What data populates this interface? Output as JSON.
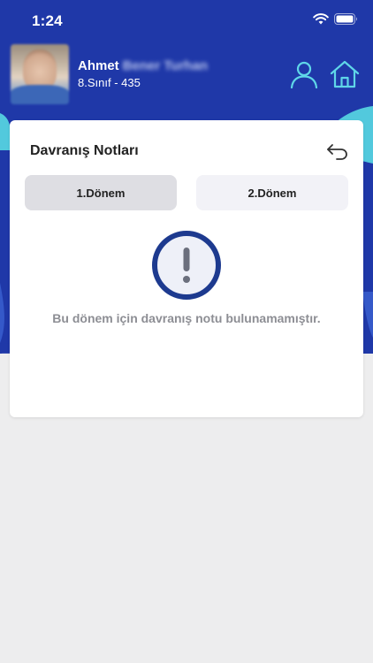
{
  "status_bar": {
    "time": "1:24"
  },
  "header": {
    "student_first_name": "Ahmet",
    "student_surname_blurred": "Bener Turhan",
    "student_class": "8.Sınıf - 435"
  },
  "card": {
    "title": "Davranış Notları",
    "tabs": [
      {
        "label": "1.Dönem",
        "selected": true
      },
      {
        "label": "2.Dönem",
        "selected": false
      }
    ],
    "empty_message": "Bu dönem için davranış notu bulunamamıştır."
  },
  "colors": {
    "header_blue": "#1f38a8",
    "accent_cyan": "#4ec9dd",
    "alert_ring": "#1d3a8f",
    "background": "#ededee"
  },
  "icons": [
    "wifi-icon",
    "battery-icon",
    "user-icon",
    "home-icon",
    "back-arrow-icon",
    "exclamation-icon"
  ]
}
